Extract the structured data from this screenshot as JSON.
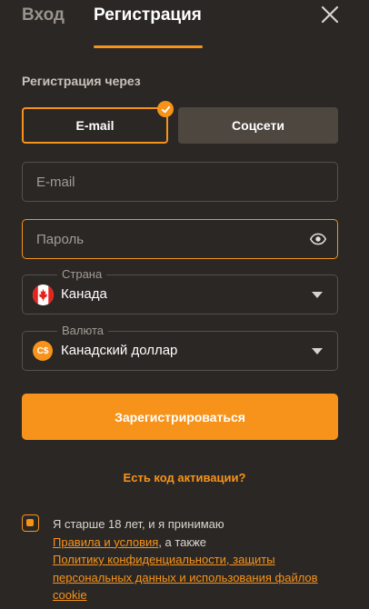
{
  "tabs": {
    "login": "Вход",
    "register": "Регистрация"
  },
  "section_label": "Регистрация через",
  "methods": {
    "email": "E-mail",
    "social": "Соцсети"
  },
  "fields": {
    "email_placeholder": "E-mail",
    "password_placeholder": "Пароль"
  },
  "country": {
    "label": "Страна",
    "value": "Канада"
  },
  "currency": {
    "label": "Валюта",
    "value": "Канадский доллар",
    "symbol": "C$"
  },
  "submit_label": "Зарегистрироваться",
  "activation_link": "Есть код активации?",
  "agreement": {
    "text_1": "Я старше 18 лет, и я принимаю",
    "terms_link": "Правила и условия",
    "text_2": ", а также",
    "privacy_link": "Политику конфиденциальности, защиты персональных данных и использования файлов cookie"
  },
  "colors": {
    "accent": "#f7931a",
    "background": "#2b2724",
    "secondary_button": "#4e4740"
  },
  "icons": [
    "close-icon",
    "check-icon",
    "eye-icon",
    "canada-flag-icon",
    "currency-coin-icon",
    "caret-down-icon"
  ]
}
